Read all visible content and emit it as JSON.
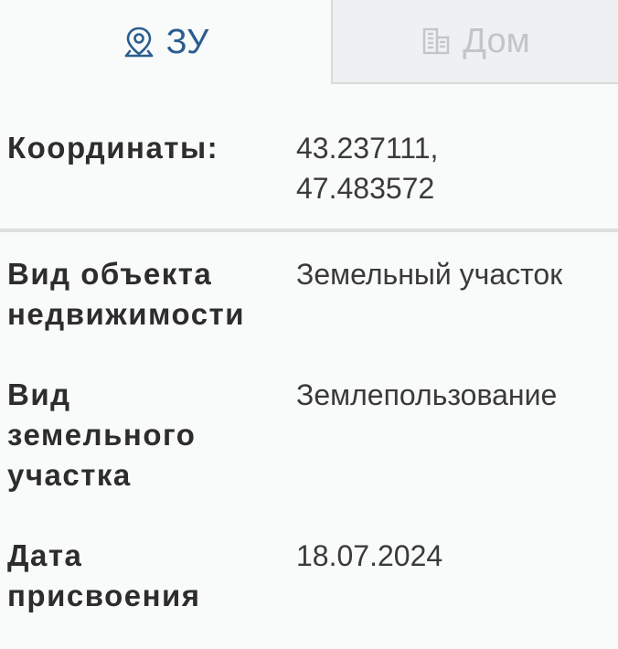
{
  "tabs": [
    {
      "label": "ЗУ",
      "icon": "map-pin-icon",
      "active": true,
      "color": "#2a5d8f"
    },
    {
      "label": "Дом",
      "icon": "building-icon",
      "active": false,
      "color": "#c2c6c9"
    }
  ],
  "details": {
    "coordinates": {
      "label": "Координаты:",
      "value_line1": "43.237111,",
      "value_line2": "47.483572"
    },
    "object_type": {
      "label_line1": "Вид объекта",
      "label_line2": "недвижимости",
      "value": "Земельный участок"
    },
    "land_type": {
      "label_line1": "Вид",
      "label_line2": "земельного",
      "label_line3": "участка",
      "value": "Землепользование"
    },
    "assign_date": {
      "label_line1": "Дата",
      "label_line2": "присвоения",
      "value": "18.07.2024"
    }
  }
}
